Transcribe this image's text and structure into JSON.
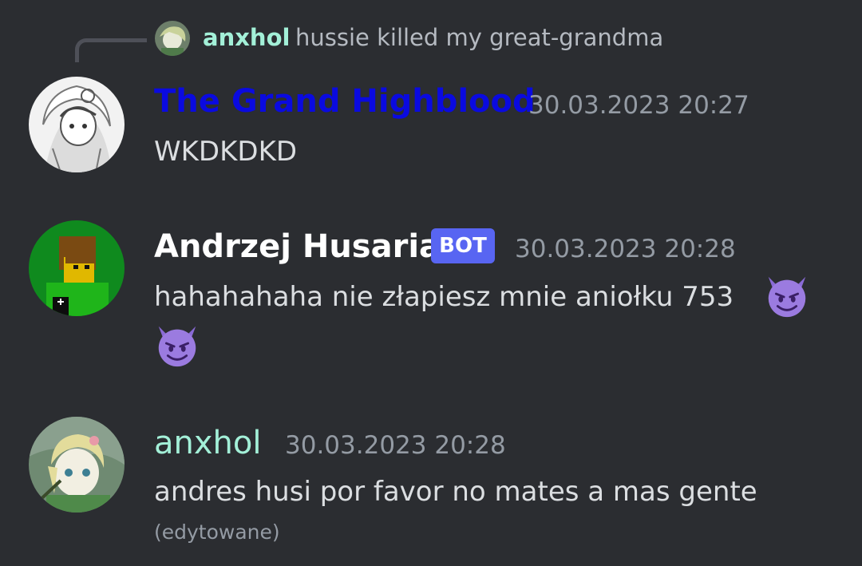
{
  "reply": {
    "username": "anxhol",
    "text": "hussie killed my great-grandma"
  },
  "messages": [
    {
      "username": "The Grand Highblood",
      "username_color": "#0a0ae0",
      "timestamp": "30.03.2023 20:27",
      "text": "WKDKDKD"
    },
    {
      "username": "Andrzej Husaria",
      "username_color": "#ffffff",
      "bot_tag": "BOT",
      "timestamp": "30.03.2023 20:28",
      "text": "hahahahaha nie złapiesz mnie aniołku 753",
      "emojis": [
        "smiling-imp-emoji",
        "smiling-imp-emoji"
      ]
    },
    {
      "username": "anxhol",
      "username_color": "#a3f0d8",
      "timestamp": "30.03.2023 20:28",
      "text": "andres husi por favor no mates a mas gente",
      "edited": "(edytowane)"
    }
  ],
  "colors": {
    "background": "#2b2d31",
    "text": "#dbdee1",
    "muted": "#949ba4",
    "bot_tag": "#5865f2"
  }
}
